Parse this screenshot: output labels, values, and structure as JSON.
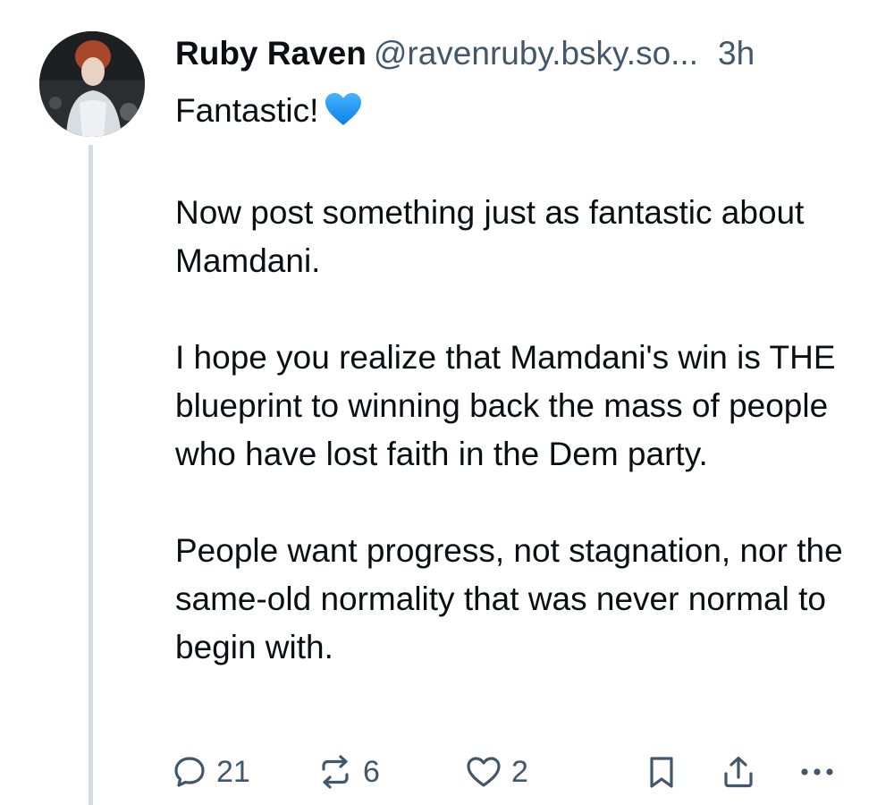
{
  "author": {
    "display_name": "Ruby Raven",
    "handle": "@ravenruby.bsky.so...",
    "time": "3h",
    "avatar_icon": "profile-photo"
  },
  "post": {
    "paragraphs": [
      "Fantastic!",
      "Now post something just as fantastic about Mamdani.",
      "I hope you realize that Mamdani's win is THE blueprint to winning back the mass of people who have lost faith in the Dem party.",
      "People want progress, not stagnation, nor the same-old normality that was never normal to begin with."
    ],
    "emoji": "blue-heart-icon"
  },
  "actions": {
    "reply_count": "21",
    "repost_count": "6",
    "like_count": "2"
  },
  "colors": {
    "text": "#0b0f14",
    "muted": "#42576c",
    "thread_line": "#d4dbe2",
    "heart": "#1e90ff"
  }
}
